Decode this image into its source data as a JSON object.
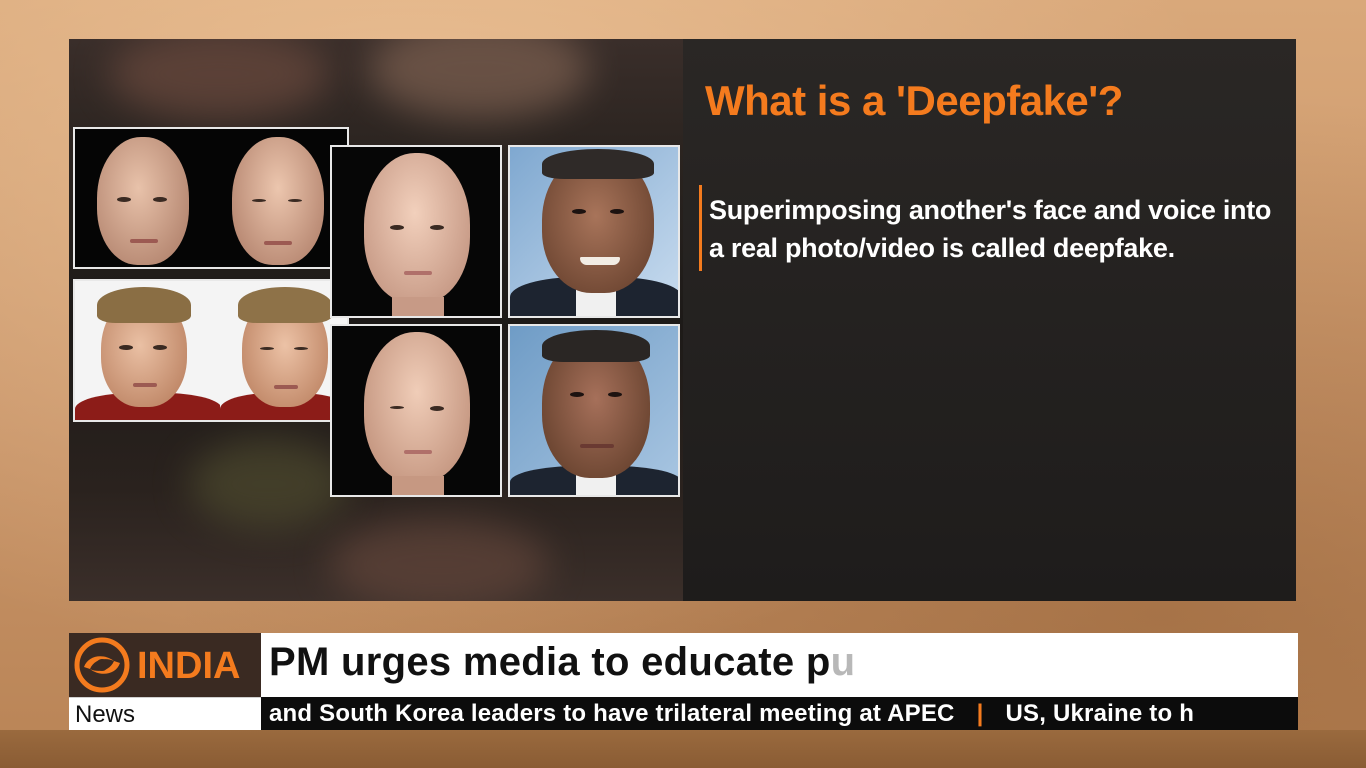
{
  "slide": {
    "title": "What is a 'Deepfake'?",
    "description": "Superimposing another's face and voice into a real photo/video is called deepfake."
  },
  "channel": {
    "logo_text": "INDIA",
    "news_label": "News",
    "brand_color": "#f47b1e"
  },
  "headline": {
    "text": "PM urges media to educate p",
    "faded_text": "u"
  },
  "ticker": {
    "items": [
      "and South Korea leaders to have trilateral meeting at APEC",
      "US, Ukraine to h"
    ],
    "separator": "|"
  },
  "images": [
    {
      "name": "bald-man-original",
      "icon": "face-image"
    },
    {
      "name": "bald-man-swapped",
      "icon": "face-image"
    },
    {
      "name": "young-man-original",
      "icon": "face-image"
    },
    {
      "name": "young-man-swapped",
      "icon": "face-image"
    },
    {
      "name": "bald-woman-top",
      "icon": "face-image"
    },
    {
      "name": "bald-woman-bottom",
      "icon": "face-image"
    },
    {
      "name": "obama-smiling",
      "icon": "face-image"
    },
    {
      "name": "obama-portrait",
      "icon": "face-image"
    }
  ]
}
